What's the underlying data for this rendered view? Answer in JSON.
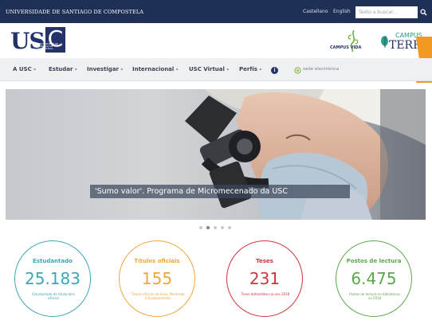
{
  "topbar": {
    "university_name": "UNIVERSIDADE DE SANTIAGO DE COMPOSTELA",
    "languages": [
      "Castellano",
      "English"
    ],
    "search_placeholder": "Texto a buscar..."
  },
  "header": {
    "logo_text": "USC",
    "logo_subtitle": "UNIVERSIDADE DE SANTIAGO DE COMPOSTELA",
    "campus_vida_label": "CAMPUS VIDA",
    "campus_terra_line1": "CAMPUS",
    "campus_terra_line2": "TERRA"
  },
  "nav": {
    "items": [
      {
        "label": "A USC -"
      },
      {
        "label": "Estudar -"
      },
      {
        "label": "Investigar -"
      },
      {
        "label": "Internacional -"
      },
      {
        "label": "USC Virtual -"
      },
      {
        "label": "Perfís -"
      }
    ],
    "sede_label": "sede electrónica"
  },
  "hero": {
    "caption": "'Sumo valor'. Programa de Micromecenado da USC",
    "slides_total": 5,
    "active_slide": 2
  },
  "stats": [
    {
      "title": "Estudantado",
      "value": "25.183",
      "description": "Estudantado de titulacións oficiais",
      "color": "#3aa7b7"
    },
    {
      "title": "Títulos oficiais",
      "value": "155",
      "description": "Títulos oficiais de Grao, Mestrado e Doutoramento",
      "color": "#f0a63a"
    },
    {
      "title": "Teses",
      "value": "231",
      "description": "Teses defendidas no ano 2018",
      "color": "#d0343d"
    },
    {
      "title": "Postos de lectura",
      "value": "6.475",
      "description": "Postos de lectura en bibliotecas no 2018",
      "color": "#5aa84a"
    }
  ],
  "colors": {
    "topbar": "#1f3057",
    "brand": "#23336a",
    "accent_orange": "#f09a24"
  }
}
